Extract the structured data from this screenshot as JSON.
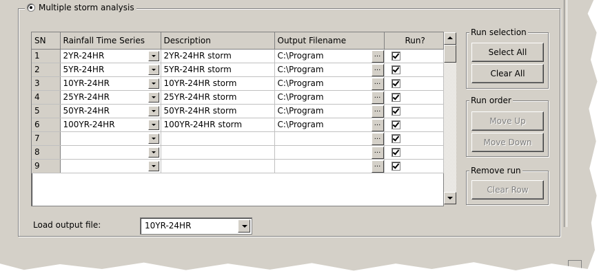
{
  "group": {
    "title": "Multiple storm analysis"
  },
  "grid": {
    "headers": [
      "SN",
      "Rainfall Time Series",
      "Description",
      "Output Filename",
      "Run?"
    ],
    "rows": [
      {
        "sn": "1",
        "series": "2YR-24HR",
        "description": "2YR-24HR storm",
        "output": "C:\\Program",
        "run": true
      },
      {
        "sn": "2",
        "series": "5YR-24HR",
        "description": "5YR-24HR storm",
        "output": "C:\\Program",
        "run": true
      },
      {
        "sn": "3",
        "series": "10YR-24HR",
        "description": "10YR-24HR storm",
        "output": "C:\\Program",
        "run": true
      },
      {
        "sn": "4",
        "series": "25YR-24HR",
        "description": "25YR-24HR storm",
        "output": "C:\\Program",
        "run": true
      },
      {
        "sn": "5",
        "series": "50YR-24HR",
        "description": "50YR-24HR storm",
        "output": "C:\\Program",
        "run": true
      },
      {
        "sn": "6",
        "series": "100YR-24HR",
        "description": "100YR-24HR storm",
        "output": "C:\\Program",
        "run": true
      },
      {
        "sn": "7",
        "series": "",
        "description": "",
        "output": "",
        "run": true
      },
      {
        "sn": "8",
        "series": "",
        "description": "",
        "output": "",
        "run": true
      },
      {
        "sn": "9",
        "series": "",
        "description": "",
        "output": "",
        "run": true
      }
    ],
    "ellipsis": "..."
  },
  "run_selection": {
    "title": "Run selection",
    "select_all": "Select All",
    "clear_all": "Clear All"
  },
  "run_order": {
    "title": "Run order",
    "move_up": "Move Up",
    "move_down": "Move Down"
  },
  "remove_run": {
    "title": "Remove run",
    "clear_row": "Clear Row"
  },
  "load_output": {
    "label": "Load output file:",
    "value": "10YR-24HR"
  },
  "colors": {
    "panel": "#d4d0c8",
    "shadow": "#808080",
    "dark": "#404040",
    "highlight": "#ffffff"
  }
}
